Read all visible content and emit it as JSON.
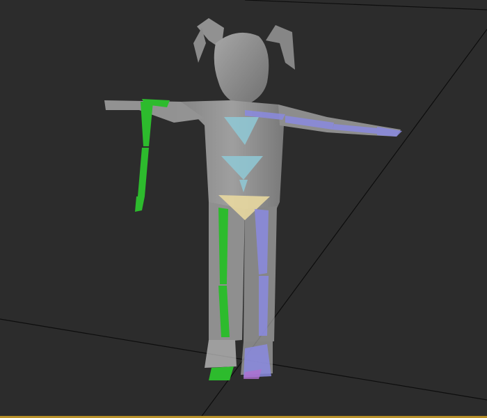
{
  "viewport": {
    "label": "",
    "background": "#2c2c2c",
    "grid_color": "#0d0d0d",
    "bottom_border_color": "#b8912a"
  },
  "character": {
    "skin_color": "#d8d8d8",
    "skin_opacity": 0.55,
    "left_side_bone_color": "#2dbb2d",
    "right_side_bone_color": "#8a8ae0",
    "spine_color": "#8fc9d6",
    "pelvis_color": "#e8d8a0",
    "foot_right_color": "#b070d0"
  },
  "rig": {
    "pose": "T-pose",
    "left_arm_state": "lowered",
    "right_arm_state": "extended"
  }
}
